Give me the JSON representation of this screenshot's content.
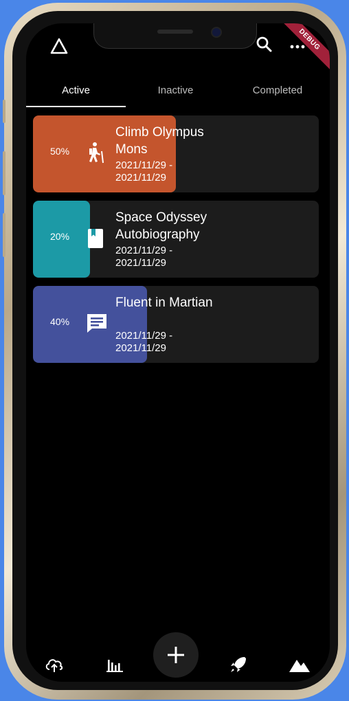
{
  "app": {
    "debug_banner": "DEBUG"
  },
  "tabs": [
    {
      "label": "Active",
      "active": true
    },
    {
      "label": "Inactive",
      "active": false
    },
    {
      "label": "Completed",
      "active": false
    }
  ],
  "goals": [
    {
      "percent_label": "50%",
      "progress": 0.5,
      "title": "Climb Olympus Mons",
      "dates": "2021/11/29 - 2021/11/29",
      "color": "#c4552d",
      "icon": "hiking-icon"
    },
    {
      "percent_label": "20%",
      "progress": 0.2,
      "title": "Space Odyssey Autobiography",
      "dates": "2021/11/29 - 2021/11/29",
      "color": "#1c9aa6",
      "icon": "book-icon"
    },
    {
      "percent_label": "40%",
      "progress": 0.4,
      "title": "Fluent in Martian",
      "dates": "2021/11/29 - 2021/11/29",
      "color": "#44519c",
      "icon": "chat-icon"
    }
  ],
  "appbar": {
    "icons": [
      "triangle-logo-icon",
      "search-icon",
      "more-icon"
    ]
  },
  "bottom_nav": {
    "icons": [
      "cloud-upload-icon",
      "bar-chart-icon",
      "add-icon",
      "rocket-icon",
      "mountain-icon"
    ]
  }
}
